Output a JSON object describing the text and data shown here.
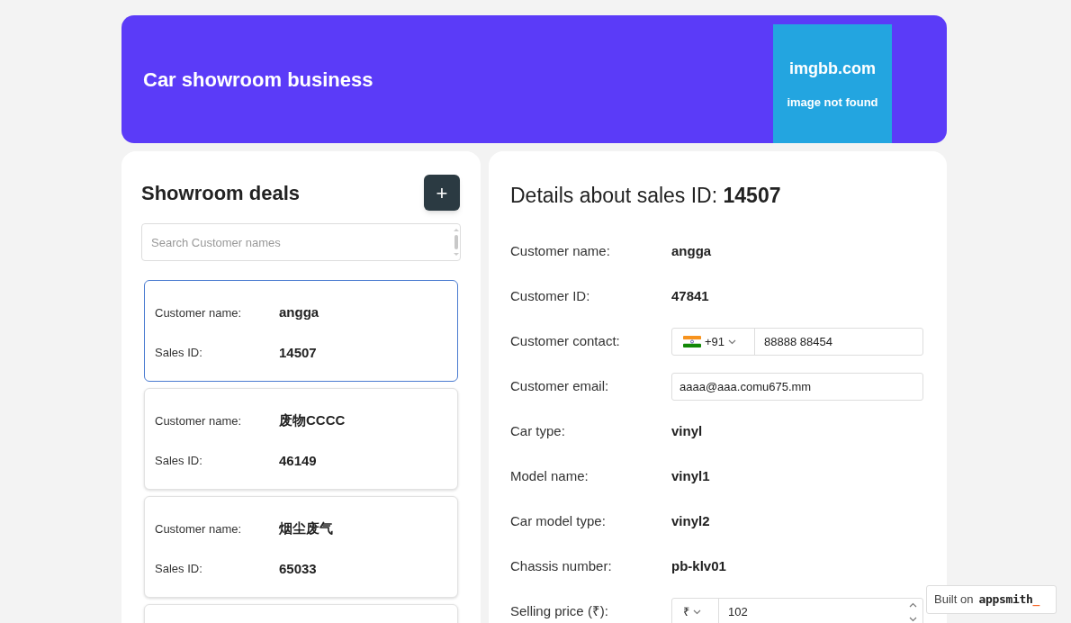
{
  "header": {
    "title": "Car showroom business",
    "image_placeholder": {
      "title": "imgbb.com",
      "subtitle": "image not found"
    }
  },
  "deals": {
    "title": "Showroom deals",
    "add_button": "+",
    "search": {
      "placeholder": "Search Customer names"
    },
    "cards": [
      {
        "name_label": "Customer name:",
        "name": "angga",
        "id_label": "Sales ID:",
        "id": "14507",
        "selected": true
      },
      {
        "name_label": "Customer name:",
        "name": "废物CCCC",
        "id_label": "Sales ID:",
        "id": "46149",
        "selected": false
      },
      {
        "name_label": "Customer name:",
        "name": "烟尘废气",
        "id_label": "Sales ID:",
        "id": "65033",
        "selected": false
      }
    ]
  },
  "details": {
    "title": "Details about sales ID: **14507**",
    "fields": [
      {
        "kind": "text",
        "label": "Customer name:",
        "value": "angga"
      },
      {
        "kind": "text",
        "label": "Customer ID:",
        "value": "47841"
      },
      {
        "kind": "phone",
        "label": "Customer contact:",
        "code": "+91",
        "value": "88888 88454"
      },
      {
        "kind": "input",
        "label": "Customer email:",
        "value": "aaaa@aaa.comu675.mm"
      },
      {
        "kind": "text",
        "label": "Car type:",
        "value": "vinyl"
      },
      {
        "kind": "text",
        "label": "Model name:",
        "value": "vinyl1"
      },
      {
        "kind": "text",
        "label": "Car model type:",
        "value": "vinyl2"
      },
      {
        "kind": "text",
        "label": "Chassis number:",
        "value": "pb-klv01"
      },
      {
        "kind": "currency",
        "label": "Selling price (₹):",
        "currency": "₹",
        "value": "102"
      }
    ]
  },
  "badge": {
    "prefix": "Built on",
    "brand": "appsmith",
    "cursor": "_"
  }
}
